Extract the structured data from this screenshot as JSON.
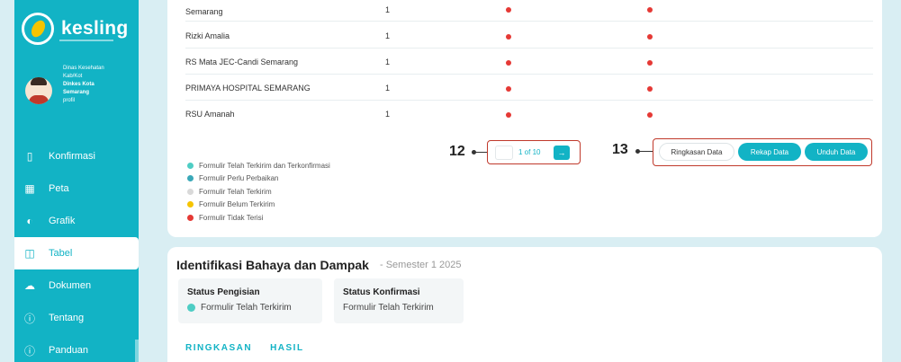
{
  "brand": {
    "name": "kesling"
  },
  "profile": {
    "lines": [
      "Dinas Kesehatan",
      "Kab/Kot",
      "Dinkes Kota",
      "Semarang",
      "profil"
    ]
  },
  "nav": [
    {
      "label": "Konfirmasi",
      "icon": "confirm-icon"
    },
    {
      "label": "Peta",
      "icon": "map-icon"
    },
    {
      "label": "Grafik",
      "icon": "chart-icon"
    },
    {
      "label": "Tabel",
      "icon": "table-icon",
      "active": true
    },
    {
      "label": "Dokumen",
      "icon": "cloud-icon"
    },
    {
      "label": "Tentang",
      "icon": "info-icon"
    },
    {
      "label": "Panduan",
      "icon": "info-icon"
    }
  ],
  "table": {
    "rows": [
      {
        "name": "Semarang",
        "count": "1"
      },
      {
        "name": "Rizki Amalia",
        "count": "1"
      },
      {
        "name": "RS Mata JEC-Candi Semarang",
        "count": "1"
      },
      {
        "name": "PRIMAYA HOSPITAL SEMARANG",
        "count": "1"
      },
      {
        "name": "RSU Amanah",
        "count": "1"
      }
    ]
  },
  "legend": [
    {
      "label": "Formulir Telah Terkirim dan Terkonfirmasi",
      "color": "#4ecdc4"
    },
    {
      "label": "Formulir Perlu Perbaikan",
      "color": "#3aa8b8"
    },
    {
      "label": "Formulir Telah Terkirim",
      "color": "#d9d9d9"
    },
    {
      "label": "Formulir Belum Terkirim",
      "color": "#f6c400"
    },
    {
      "label": "Formulir Tidak Terisi",
      "color": "#e53935"
    }
  ],
  "pagination": {
    "text": "1 of 10",
    "callout": "12"
  },
  "actions": {
    "callout": "13",
    "ringkasan": "Ringkasan Data",
    "rekap": "Rekap Data",
    "unduh": "Unduh Data"
  },
  "section": {
    "title": "Identifikasi Bahaya dan Dampak",
    "subtitle": "- Semester 1 2025",
    "status_pengisian_label": "Status Pengisian",
    "status_pengisian_value": "Formulir Telah Terkirim",
    "status_konfirmasi_label": "Status Konfirmasi",
    "status_konfirmasi_value": "Formulir Telah Terkirim",
    "tabs": [
      "RINGKASAN",
      "HASIL"
    ]
  }
}
